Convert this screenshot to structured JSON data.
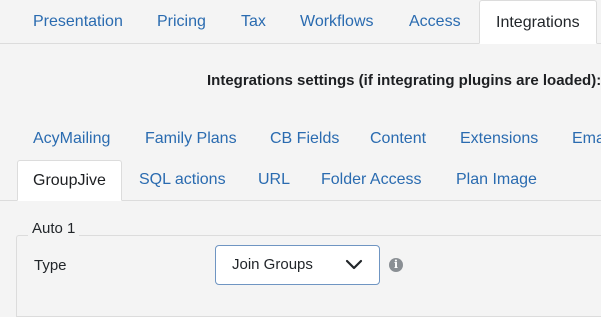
{
  "main_tabs": [
    {
      "label": "Presentation"
    },
    {
      "label": "Pricing"
    },
    {
      "label": "Tax"
    },
    {
      "label": "Workflows"
    },
    {
      "label": "Access"
    },
    {
      "label": "Integrations",
      "active": true
    }
  ],
  "integrations": {
    "title": "Integrations settings (if integrating plugins are loaded):",
    "sub_tabs_row1": [
      {
        "label": "AcyMailing"
      },
      {
        "label": "Family Plans"
      },
      {
        "label": "CB Fields"
      },
      {
        "label": "Content"
      },
      {
        "label": "Extensions"
      },
      {
        "label": "Ema"
      }
    ],
    "sub_tabs_row2": [
      {
        "label": "GroupJive",
        "active": true
      },
      {
        "label": "SQL actions"
      },
      {
        "label": "URL"
      },
      {
        "label": "Folder Access"
      },
      {
        "label": "Plan Image"
      }
    ],
    "fieldset": {
      "legend": "Auto 1",
      "type_label": "Type",
      "type_value": "Join Groups",
      "info_glyph": "i"
    }
  },
  "colors": {
    "link": "#2a6bb0",
    "background": "#f4f4f4",
    "select_border": "#6f95c2"
  }
}
